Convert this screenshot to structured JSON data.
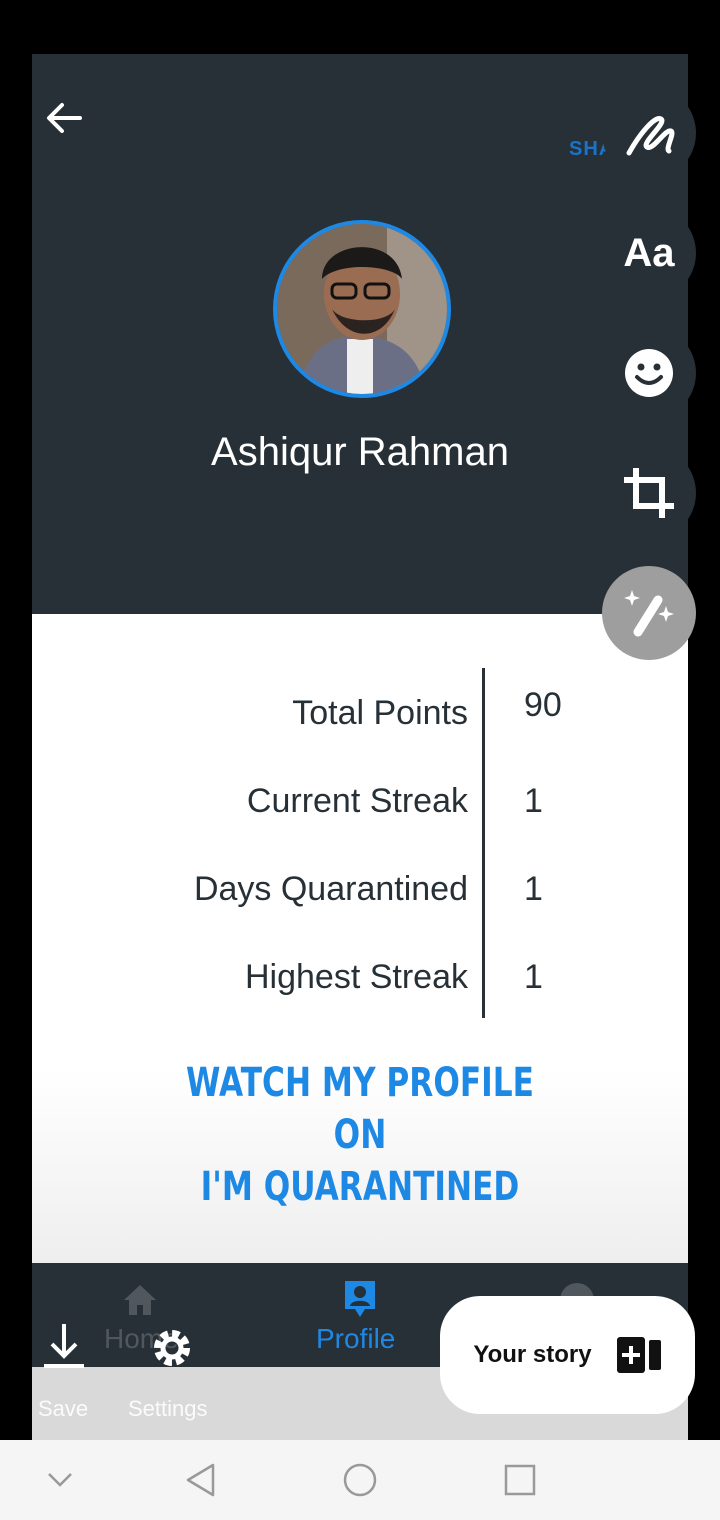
{
  "header": {
    "share_label": "SHARE"
  },
  "profile": {
    "name": "Ashiqur Rahman"
  },
  "stats": [
    {
      "label": "Total Points",
      "value": "90"
    },
    {
      "label": "Current Streak",
      "value": "1"
    },
    {
      "label": "Days Quarantined",
      "value": "1"
    },
    {
      "label": "Highest Streak",
      "value": "1"
    }
  ],
  "promo": {
    "line1": "WATCH MY PROFILE",
    "line2": "ON",
    "line3": "I'M QUARANTINED"
  },
  "bottom_nav": {
    "home_label": "Home",
    "profile_label": "Profile"
  },
  "story_actions": {
    "save_label": "Save",
    "settings_label": "Settings",
    "your_story_label": "Your story"
  },
  "tools": [
    "draw-icon",
    "text-tool-icon",
    "sticker-icon",
    "crop-icon",
    "effects-icon"
  ],
  "colors": {
    "header_bg": "#263036",
    "accent": "#1e88e5"
  }
}
